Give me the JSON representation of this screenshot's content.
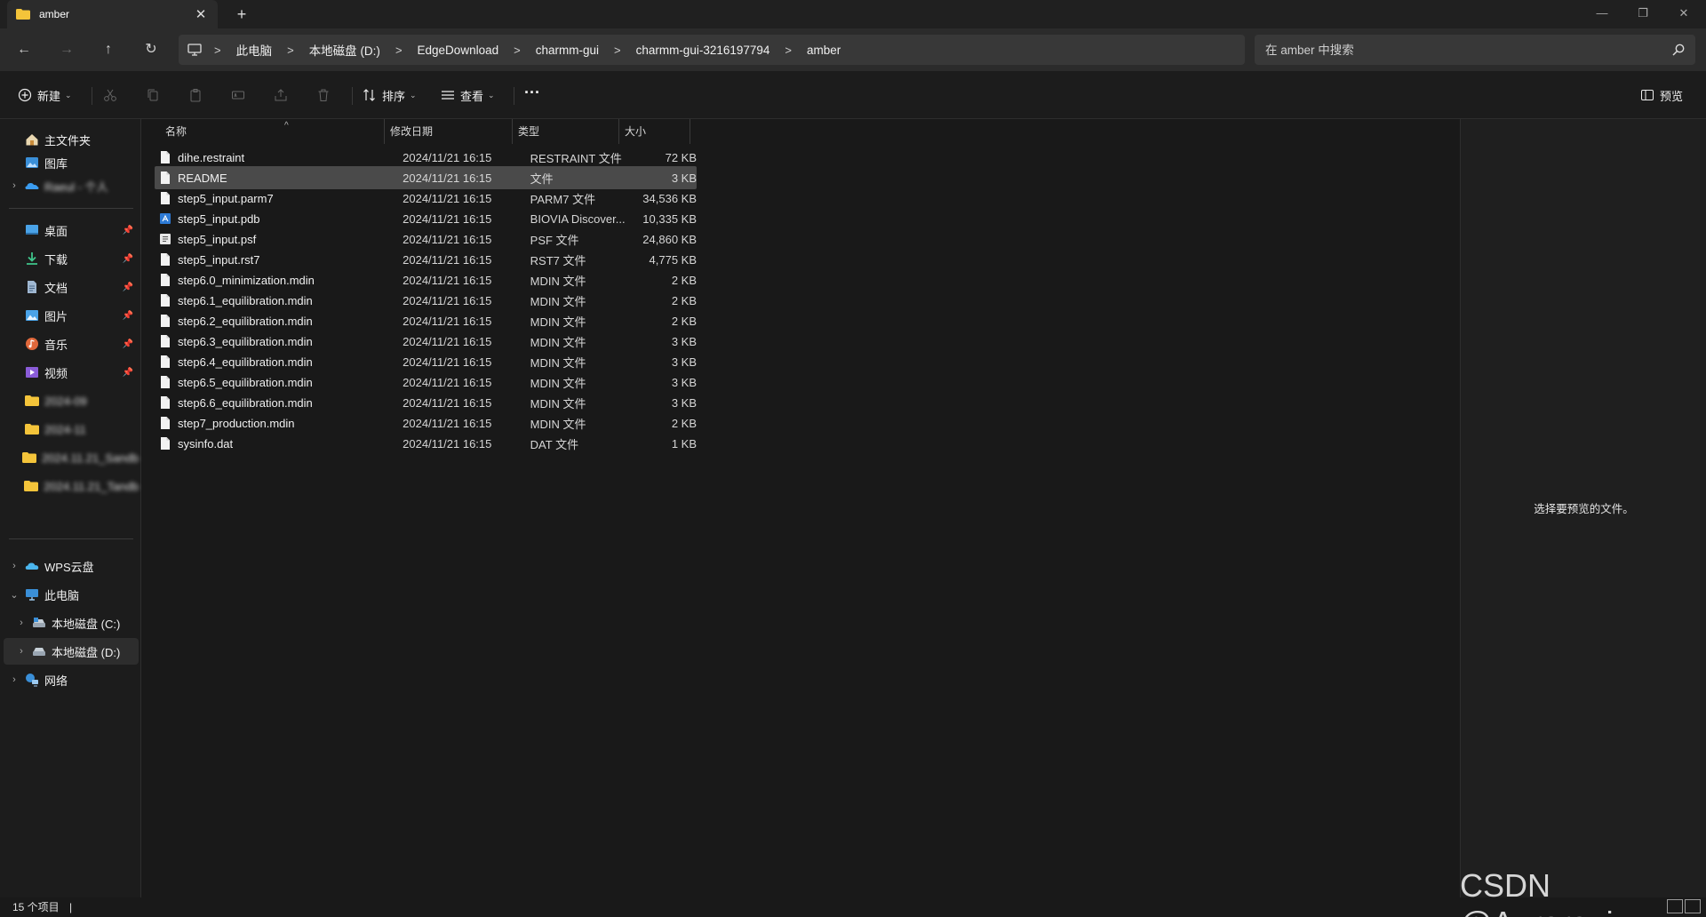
{
  "window": {
    "tab_title": "amber",
    "tab_close": "✕",
    "new_tab": "+",
    "controls": {
      "minimize": "—",
      "restore": "❐",
      "close": "✕"
    }
  },
  "nav": {
    "back": "←",
    "forward": "→",
    "up": "↑",
    "refresh": "↻",
    "breadcrumb": [
      "此电脑",
      "本地磁盘 (D:)",
      "EdgeDownload",
      "charmm-gui",
      "charmm-gui-3216197794",
      "amber"
    ],
    "sep": ">",
    "search_placeholder": "在 amber 中搜索"
  },
  "toolbar": {
    "new_label": "新建",
    "sort_label": "排序",
    "view_label": "查看",
    "more_label": "···",
    "preview_label": "预览"
  },
  "sidebar": {
    "quick": [
      {
        "label": "主文件夹",
        "icon": "home-icon"
      },
      {
        "label": "图库",
        "icon": "gallery-icon"
      },
      {
        "label": "Raeul - 个人",
        "icon": "onedrive-icon",
        "blurred": true
      }
    ],
    "pinned": [
      {
        "label": "桌面",
        "icon": "desktop-icon"
      },
      {
        "label": "下载",
        "icon": "download-icon"
      },
      {
        "label": "文档",
        "icon": "documents-icon"
      },
      {
        "label": "图片",
        "icon": "pictures-icon"
      },
      {
        "label": "音乐",
        "icon": "music-icon"
      },
      {
        "label": "视频",
        "icon": "videos-icon"
      }
    ],
    "recent_folders": [
      "2024-09",
      "2024-11",
      "2024.11.21_Sandb",
      "2024.11.21_Tandb"
    ],
    "locations": [
      {
        "label": "WPS云盘",
        "icon": "cloud-icon"
      },
      {
        "label": "此电脑",
        "icon": "pc-icon"
      },
      {
        "label": "本地磁盘 (C:)",
        "icon": "drive-icon"
      },
      {
        "label": "本地磁盘 (D:)",
        "icon": "drive-icon"
      },
      {
        "label": "网络",
        "icon": "network-icon"
      }
    ]
  },
  "columns": {
    "name": "名称",
    "date": "修改日期",
    "type": "类型",
    "size": "大小"
  },
  "files": [
    {
      "name": "dihe.restraint",
      "date": "2024/11/21 16:15",
      "type": "RESTRAINT 文件",
      "size": "72 KB",
      "icon": "file-icon"
    },
    {
      "name": "README",
      "date": "2024/11/21 16:15",
      "type": "文件",
      "size": "3 KB",
      "icon": "file-icon",
      "selected": true
    },
    {
      "name": "step5_input.parm7",
      "date": "2024/11/21 16:15",
      "type": "PARM7 文件",
      "size": "34,536 KB",
      "icon": "file-icon"
    },
    {
      "name": "step5_input.pdb",
      "date": "2024/11/21 16:15",
      "type": "BIOVIA Discover...",
      "size": "10,335 KB",
      "icon": "pdb-file-icon"
    },
    {
      "name": "step5_input.psf",
      "date": "2024/11/21 16:15",
      "type": "PSF 文件",
      "size": "24,860 KB",
      "icon": "text-file-icon"
    },
    {
      "name": "step5_input.rst7",
      "date": "2024/11/21 16:15",
      "type": "RST7 文件",
      "size": "4,775 KB",
      "icon": "file-icon"
    },
    {
      "name": "step6.0_minimization.mdin",
      "date": "2024/11/21 16:15",
      "type": "MDIN 文件",
      "size": "2 KB",
      "icon": "file-icon"
    },
    {
      "name": "step6.1_equilibration.mdin",
      "date": "2024/11/21 16:15",
      "type": "MDIN 文件",
      "size": "2 KB",
      "icon": "file-icon"
    },
    {
      "name": "step6.2_equilibration.mdin",
      "date": "2024/11/21 16:15",
      "type": "MDIN 文件",
      "size": "2 KB",
      "icon": "file-icon"
    },
    {
      "name": "step6.3_equilibration.mdin",
      "date": "2024/11/21 16:15",
      "type": "MDIN 文件",
      "size": "3 KB",
      "icon": "file-icon"
    },
    {
      "name": "step6.4_equilibration.mdin",
      "date": "2024/11/21 16:15",
      "type": "MDIN 文件",
      "size": "3 KB",
      "icon": "file-icon"
    },
    {
      "name": "step6.5_equilibration.mdin",
      "date": "2024/11/21 16:15",
      "type": "MDIN 文件",
      "size": "3 KB",
      "icon": "file-icon"
    },
    {
      "name": "step6.6_equilibration.mdin",
      "date": "2024/11/21 16:15",
      "type": "MDIN 文件",
      "size": "3 KB",
      "icon": "file-icon"
    },
    {
      "name": "step7_production.mdin",
      "date": "2024/11/21 16:15",
      "type": "MDIN 文件",
      "size": "2 KB",
      "icon": "file-icon"
    },
    {
      "name": "sysinfo.dat",
      "date": "2024/11/21 16:15",
      "type": "DAT 文件",
      "size": "1 KB",
      "icon": "file-icon"
    }
  ],
  "preview": {
    "message": "选择要预览的文件。"
  },
  "status": {
    "count": "15 个项目",
    "sep": "|"
  },
  "watermark": "CSDN @Aurora_j",
  "colors": {
    "folder": "#f4c43a",
    "accent": "#4ca0e0",
    "selected_row": "#4a4a4a"
  }
}
